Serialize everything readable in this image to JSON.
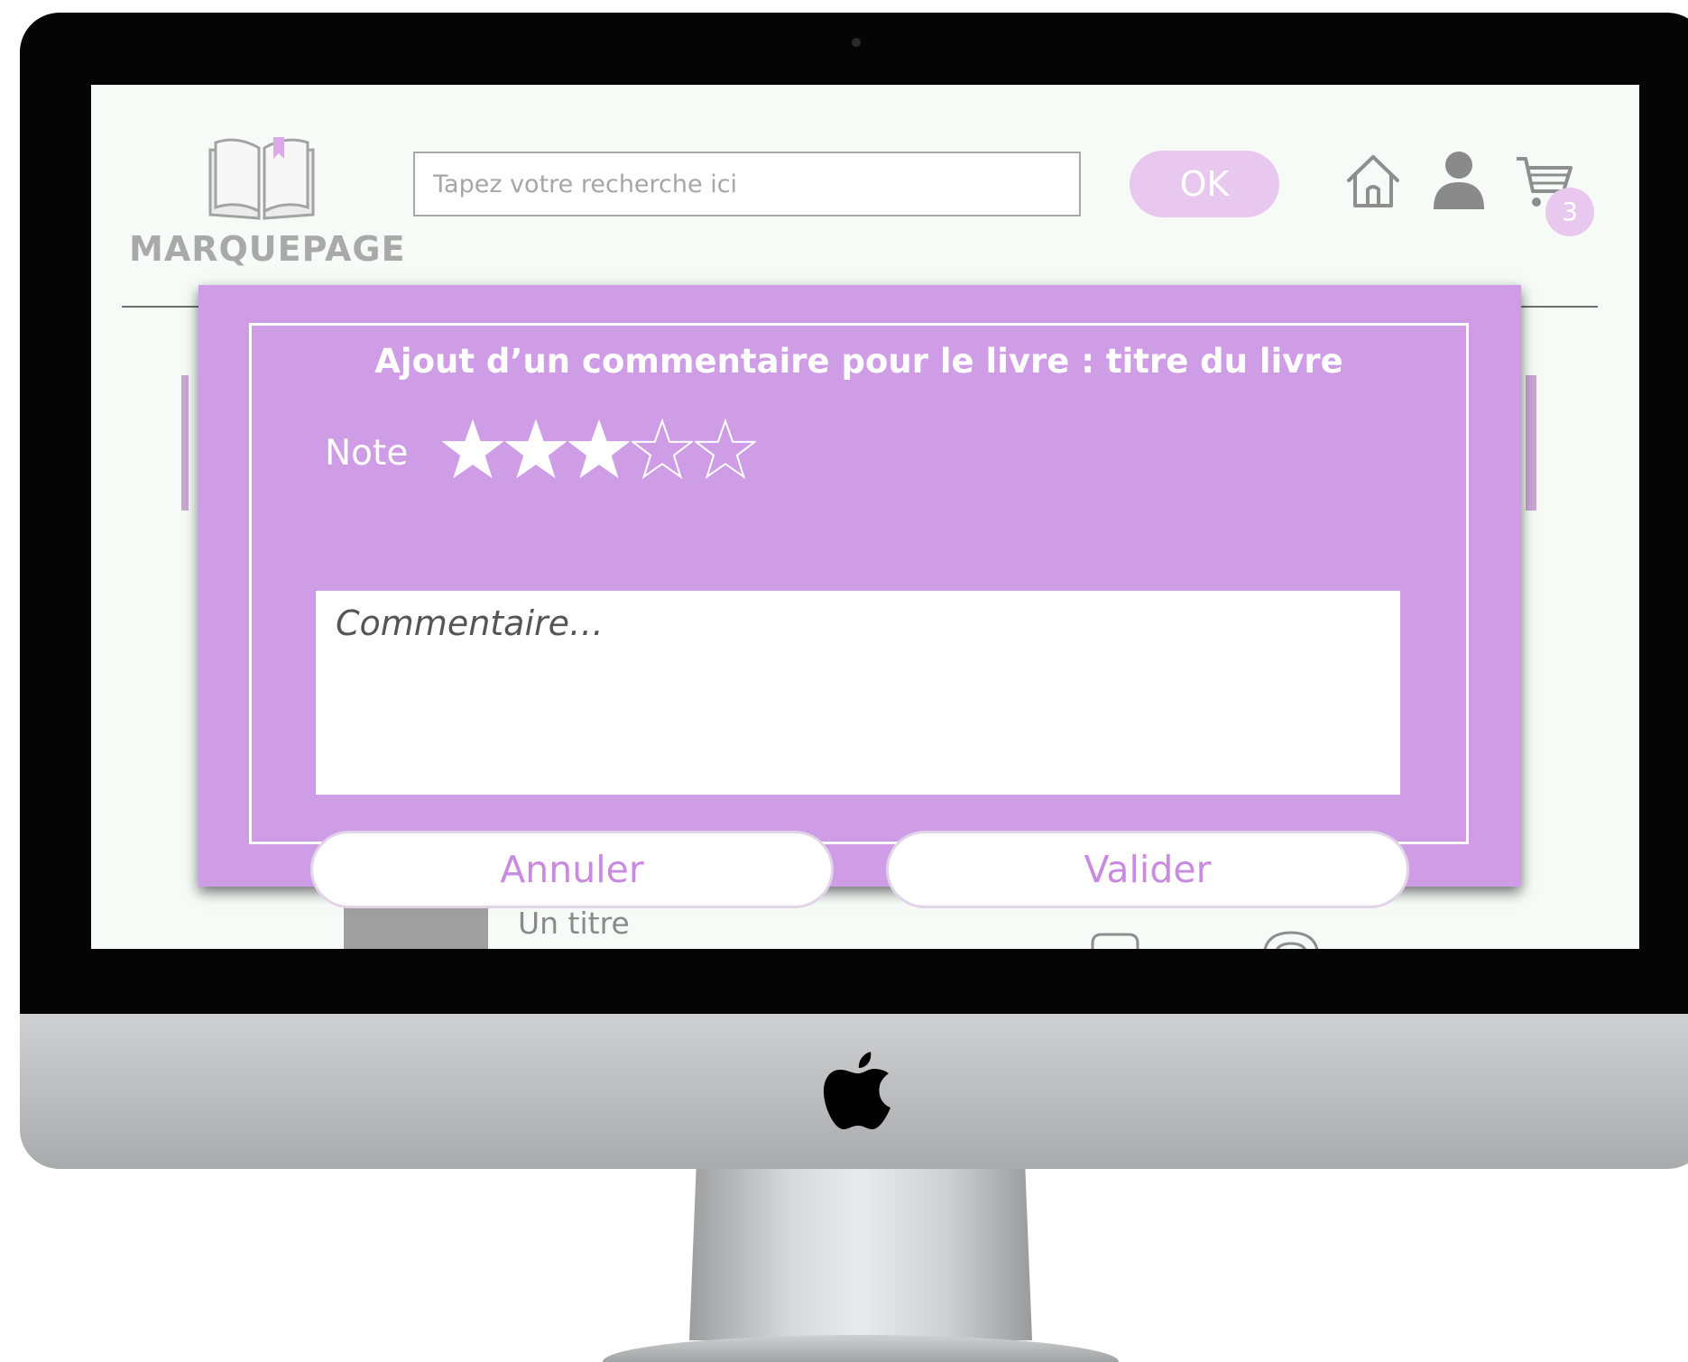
{
  "header": {
    "logo_text": "MarquePage",
    "search": {
      "placeholder": "Tapez votre recherche ici",
      "value": ""
    },
    "ok_label": "OK",
    "cart_count": "3"
  },
  "background_list": {
    "item_title": "Un titre"
  },
  "modal": {
    "title": "Ajout d’un commentaire pour le livre : titre du livre",
    "note_label": "Note",
    "rating": {
      "value": 3,
      "max": 5
    },
    "comment_placeholder": "Commentaire…",
    "cancel_label": "Annuler",
    "validate_label": "Valider"
  },
  "colors": {
    "accent_purple": "#cf9ce6",
    "button_text": "#c98bdf",
    "ok_button": "#e8c8ee",
    "screen_bg": "#f6fbf8"
  },
  "icons": [
    "home-icon",
    "user-icon",
    "cart-icon",
    "star-icon",
    "apple-logo-icon"
  ]
}
